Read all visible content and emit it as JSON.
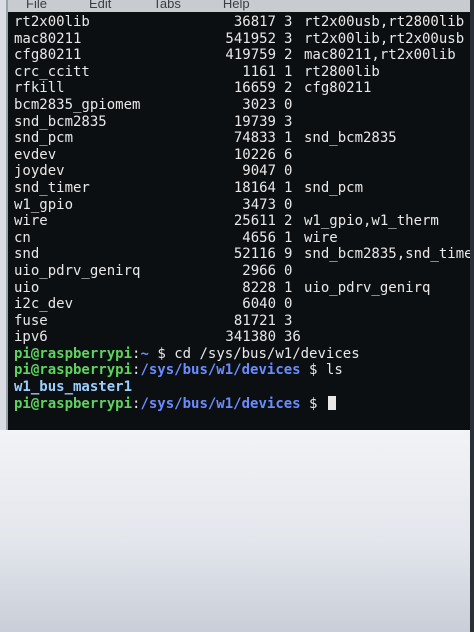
{
  "menubar": {
    "items": [
      "File",
      "Edit",
      "Tabs",
      "Help"
    ]
  },
  "modules": [
    {
      "name": "rt2x00lib",
      "size": "36817",
      "used": "3",
      "by": "rt2x00usb,rt2800lib"
    },
    {
      "name": "mac80211",
      "size": "541952",
      "used": "3",
      "by": "rt2x00lib,rt2x00usb"
    },
    {
      "name": "cfg80211",
      "size": "419759",
      "used": "2",
      "by": "mac80211,rt2x00lib"
    },
    {
      "name": "crc_ccitt",
      "size": "1161",
      "used": "1",
      "by": "rt2800lib"
    },
    {
      "name": "rfkill",
      "size": "16659",
      "used": "2",
      "by": "cfg80211"
    },
    {
      "name": "bcm2835_gpiomem",
      "size": "3023",
      "used": "0",
      "by": ""
    },
    {
      "name": "snd_bcm2835",
      "size": "19739",
      "used": "3",
      "by": ""
    },
    {
      "name": "snd_pcm",
      "size": "74833",
      "used": "1",
      "by": "snd_bcm2835"
    },
    {
      "name": "evdev",
      "size": "10226",
      "used": "6",
      "by": ""
    },
    {
      "name": "joydev",
      "size": "9047",
      "used": "0",
      "by": ""
    },
    {
      "name": "snd_timer",
      "size": "18164",
      "used": "1",
      "by": "snd_pcm"
    },
    {
      "name": "w1_gpio",
      "size": "3473",
      "used": "0",
      "by": ""
    },
    {
      "name": "wire",
      "size": "25611",
      "used": "2",
      "by": "w1_gpio,w1_therm"
    },
    {
      "name": "cn",
      "size": "4656",
      "used": "1",
      "by": "wire"
    },
    {
      "name": "snd",
      "size": "52116",
      "used": "9",
      "by": "snd_bcm2835,snd_time"
    },
    {
      "name": "uio_pdrv_genirq",
      "size": "2966",
      "used": "0",
      "by": ""
    },
    {
      "name": "uio",
      "size": "8228",
      "used": "1",
      "by": "uio_pdrv_genirq"
    },
    {
      "name": "i2c_dev",
      "size": "6040",
      "used": "0",
      "by": ""
    },
    {
      "name": "fuse",
      "size": "81721",
      "used": "3",
      "by": ""
    },
    {
      "name": "ipv6",
      "size": "341380",
      "used": "36",
      "by": ""
    }
  ],
  "session": [
    {
      "user": "pi@raspberrypi",
      "sep": ":",
      "path": "~",
      "sym": " $ ",
      "cmd": "cd /sys/bus/w1/devices"
    },
    {
      "user": "pi@raspberrypi",
      "sep": ":",
      "path": "/sys/bus/w1/devices",
      "sym": " $ ",
      "cmd": "ls"
    }
  ],
  "ls_output": "w1_bus_master1",
  "current_prompt": {
    "user": "pi@raspberrypi",
    "sep": ":",
    "path": "/sys/bus/w1/devices",
    "sym": " $ "
  }
}
